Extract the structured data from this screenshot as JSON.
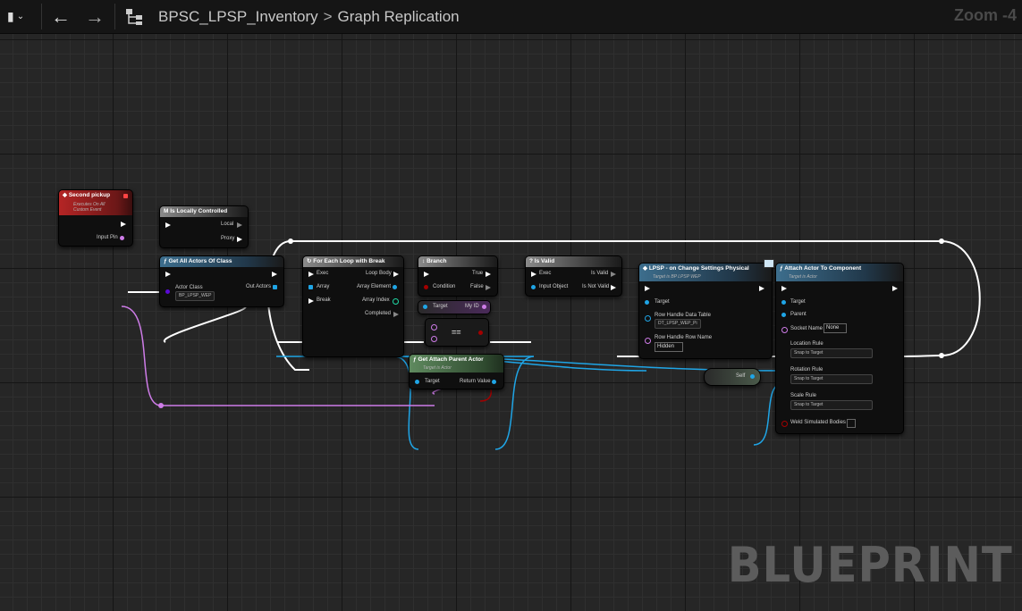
{
  "toolbar": {
    "breadcrumb_root": "BPSC_LPSP_Inventory",
    "breadcrumb_sep": ">",
    "breadcrumb_current": "Graph Replication",
    "zoom": "Zoom -4"
  },
  "nodes": {
    "second_pickup": {
      "title": "Second pickup",
      "subtitle": "Executes On All Custom Event",
      "pin_input": "Input Pin"
    },
    "is_locally_controlled": {
      "title": "Is Locally Controlled",
      "pin_local": "Local",
      "pin_proxy": "Proxy"
    },
    "get_all_actors": {
      "title": "Get All Actors Of Class",
      "pin_actor_class": "Actor Class",
      "actor_class_value": "BP_LPSP_WEP",
      "pin_out": "Out Actors"
    },
    "for_each": {
      "title": "For Each Loop with Break",
      "pin_exec": "Exec",
      "pin_array": "Array",
      "pin_break": "Break",
      "pin_loop_body": "Loop Body",
      "pin_array_element": "Array Element",
      "pin_array_index": "Array Index",
      "pin_completed": "Completed"
    },
    "branch": {
      "title": "Branch",
      "pin_condition": "Condition",
      "pin_true": "True",
      "pin_false": "False"
    },
    "target_myid": {
      "pin_target": "Target",
      "pin_myid": "My ID"
    },
    "equal": {
      "symbol": "=="
    },
    "get_attach_parent": {
      "title": "Get Attach Parent Actor",
      "subtitle": "Target is Actor",
      "pin_target": "Target",
      "pin_return": "Return Value"
    },
    "is_valid": {
      "title": "Is Valid",
      "pin_exec": "Exec",
      "pin_input": "Input Object",
      "pin_is_valid": "Is Valid",
      "pin_is_not_valid": "Is Not Valid"
    },
    "lpsp_change": {
      "title": "LPSP - on Change Settings Physical",
      "subtitle": "Target is BP LPSP WEP",
      "pin_target": "Target",
      "pin_row_table": "Row Handle Data Table",
      "row_table_value": "DT_LPSP_WEP_Pi",
      "pin_row_name": "Row Handle Row Name",
      "row_name_value": "Hidden"
    },
    "self": {
      "label": "Self"
    },
    "attach": {
      "title": "Attach Actor To Component",
      "subtitle": "Target is Actor",
      "pin_target": "Target",
      "pin_parent": "Parent",
      "pin_socket": "Socket Name",
      "socket_value": "None",
      "pin_location": "Location Rule",
      "location_value": "Snap to Target",
      "pin_rotation": "Rotation Rule",
      "rotation_value": "Snap to Target",
      "pin_scale": "Scale Rule",
      "scale_value": "Snap to Target",
      "pin_weld": "Weld Simulated Bodies"
    }
  },
  "watermark": "BLUEPRINT",
  "colors": {
    "exec": "#ffffff",
    "object": "#1fa5e6",
    "struct": "#ce7ce8",
    "bool": "#a30000",
    "array": "#1fa5e6"
  }
}
